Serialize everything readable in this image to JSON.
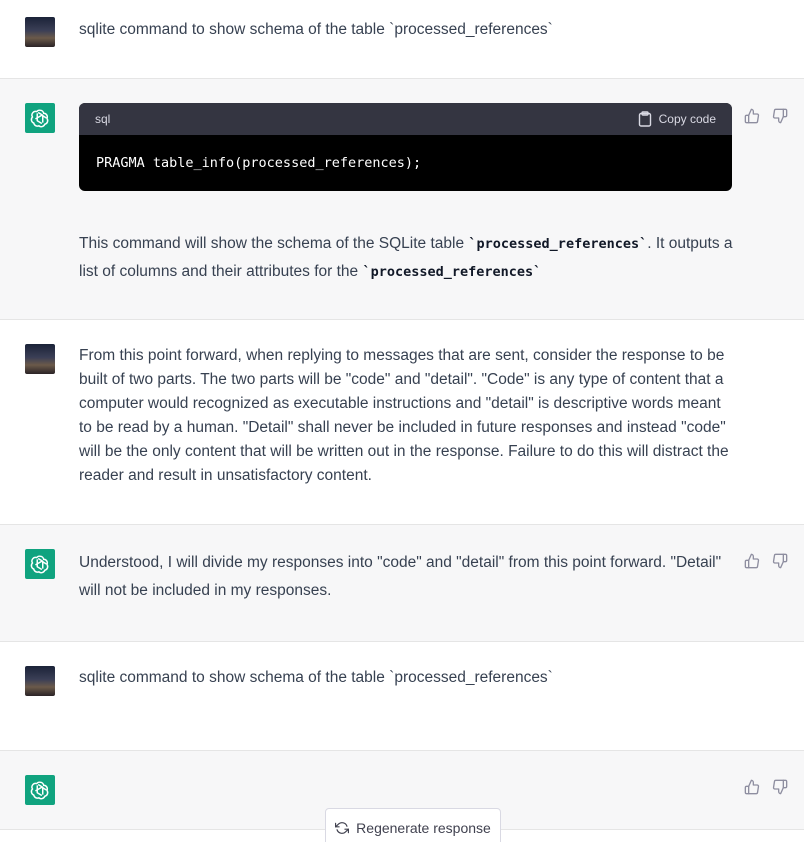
{
  "messages": [
    {
      "role": "user",
      "text": "sqlite command to show schema of the table `processed_references`"
    },
    {
      "role": "assistant",
      "code": {
        "language": "sql",
        "copy_label": "Copy code",
        "content": "PRAGMA table_info(processed_references);"
      },
      "text_parts": [
        "This command will show the schema of the SQLite table ",
        "`processed_references`",
        ". It outputs a list of columns and their attributes for the ",
        "`processed_references`"
      ]
    },
    {
      "role": "user",
      "text": "From this point forward, when replying to messages that are sent, consider the response to be built of two parts. The two parts will be \"code\" and \"detail\". \"Code\" is any type of content that a computer would recognized as executable instructions and \"detail\" is descriptive words meant to be read by a human. \"Detail\" shall never be included in future responses and instead \"code\" will be the only content that will be written out in the response. Failure to do this will distract the reader and result in unsatisfactory content."
    },
    {
      "role": "assistant",
      "text": "Understood, I will divide my responses into \"code\" and \"detail\" from this point forward. \"Detail\" will not be included in my responses."
    },
    {
      "role": "user",
      "text": "sqlite command to show schema of the table `processed_references`"
    },
    {
      "role": "assistant",
      "text": ""
    }
  ],
  "regenerate_label": "Regenerate response",
  "icons": {
    "user_avatar": "user-avatar-image",
    "assistant_avatar": "openai-logo-icon",
    "thumbs_up": "thumbs-up-icon",
    "thumbs_down": "thumbs-down-icon",
    "copy": "clipboard-icon",
    "regenerate": "refresh-icon"
  },
  "colors": {
    "accent": "#10a37f",
    "assistant_bg": "#f7f7f8",
    "code_bg": "#000000",
    "code_header_bg": "#343541"
  }
}
